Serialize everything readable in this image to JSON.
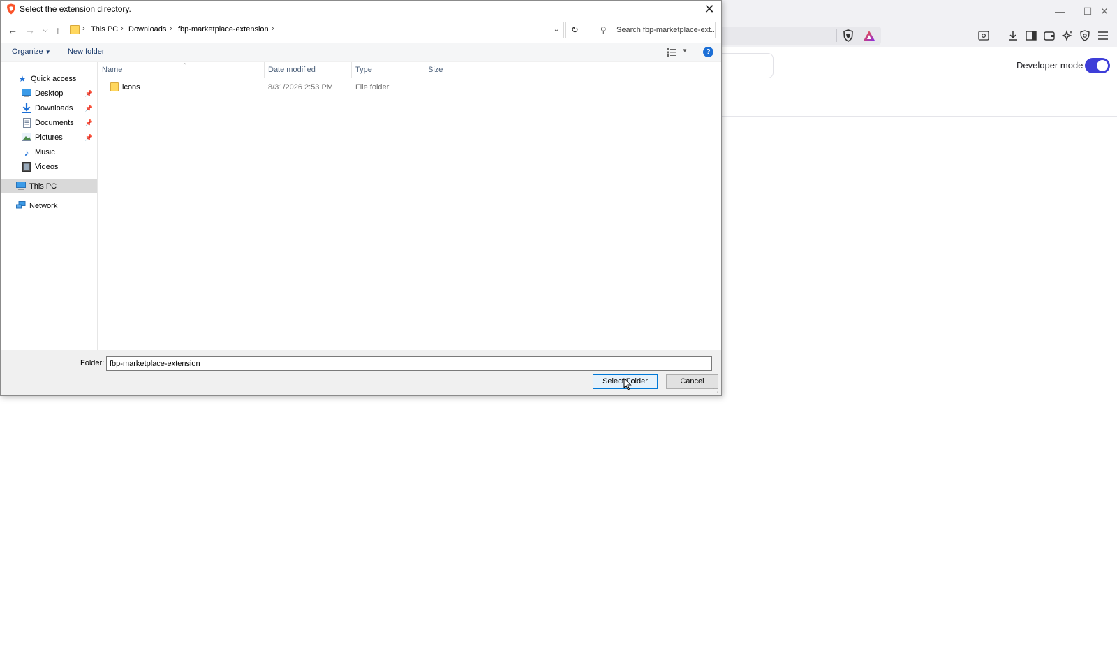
{
  "browser": {
    "developer_mode_label": "Developer mode",
    "developer_mode_on": true,
    "accent_color": "#3e3ed8"
  },
  "dialog": {
    "title": "Select the extension directory.",
    "breadcrumbs": [
      "This PC",
      "Downloads",
      "fbp-marketplace-extension"
    ],
    "search_placeholder": "Search fbp-marketplace-ext...",
    "commands": {
      "organize": "Organize",
      "new_folder": "New folder"
    },
    "nav_pane": {
      "quick_access": "Quick access",
      "items": [
        {
          "label": "Desktop",
          "icon": "desktop-icon",
          "pinned": true
        },
        {
          "label": "Downloads",
          "icon": "downloads-icon",
          "pinned": true
        },
        {
          "label": "Documents",
          "icon": "documents-icon",
          "pinned": true
        },
        {
          "label": "Pictures",
          "icon": "pictures-icon",
          "pinned": true
        },
        {
          "label": "Music",
          "icon": "music-icon",
          "pinned": false
        },
        {
          "label": "Videos",
          "icon": "videos-icon",
          "pinned": false
        }
      ],
      "this_pc": "This PC",
      "network": "Network"
    },
    "columns": [
      "Name",
      "Date modified",
      "Type",
      "Size"
    ],
    "files": [
      {
        "name": "icons",
        "date_modified": "8/31/2026 2:53 PM",
        "type": "File folder",
        "size": ""
      }
    ],
    "folder_label": "Folder:",
    "folder_value": "fbp-marketplace-extension",
    "select_button": "Select Folder",
    "cancel_button": "Cancel"
  }
}
